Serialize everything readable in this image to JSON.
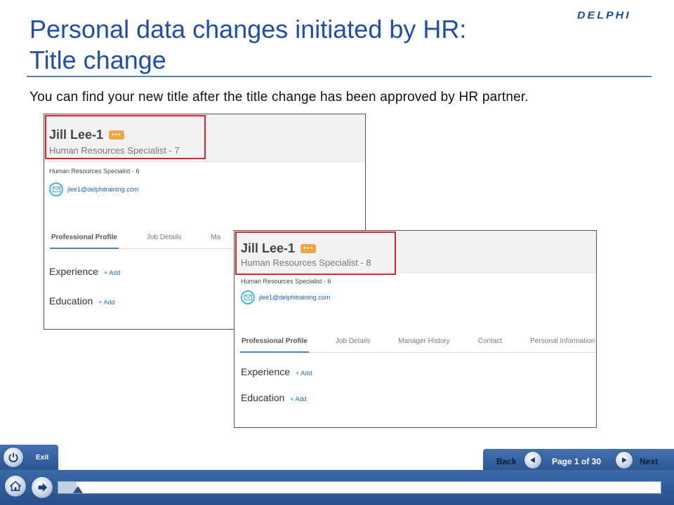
{
  "slide": {
    "title_line1": "Personal data changes initiated by HR:",
    "title_line2": "Title change",
    "logo": "DELPHI",
    "intro": "You can find your new title after the title change has been approved by HR partner."
  },
  "profile_before": {
    "name": "Jill Lee-1",
    "title": "Human Resources Specialist - 7",
    "sub_title": "Human Resources Specialist - 6",
    "email": "jlee1@delphitraining.com",
    "tabs": [
      "Professional Profile",
      "Job Details",
      "Ma"
    ],
    "sections": [
      {
        "label": "Experience",
        "add": "+ Add"
      },
      {
        "label": "Education",
        "add": "+ Add"
      }
    ]
  },
  "profile_after": {
    "name": "Jill Lee-1",
    "title": "Human Resources Specialist - 8",
    "sub_title": "Human Resources Specialist - 6",
    "email": "jlee1@delphitraining.com",
    "tabs": [
      "Professional Profile",
      "Job Details",
      "Manager History",
      "Contact",
      "Personal Information"
    ],
    "sections": [
      {
        "label": "Experience",
        "add": "+ Add"
      },
      {
        "label": "Education",
        "add": "+ Add"
      }
    ]
  },
  "navigation": {
    "exit_label": "Exit",
    "back_label": "Back",
    "next_label": "Next",
    "page_label": "Page 1 of 30",
    "progress": 0.03
  },
  "colors": {
    "title_blue": "#1f4fa6",
    "highlight_red": "#d9232e",
    "chat_orange": "#f0a640",
    "nav_blue": "#2b5593"
  },
  "icons": [
    "chat-icon",
    "mail-icon",
    "exit-icon",
    "home-icon",
    "forward-icon",
    "back-icon",
    "next-icon"
  ]
}
